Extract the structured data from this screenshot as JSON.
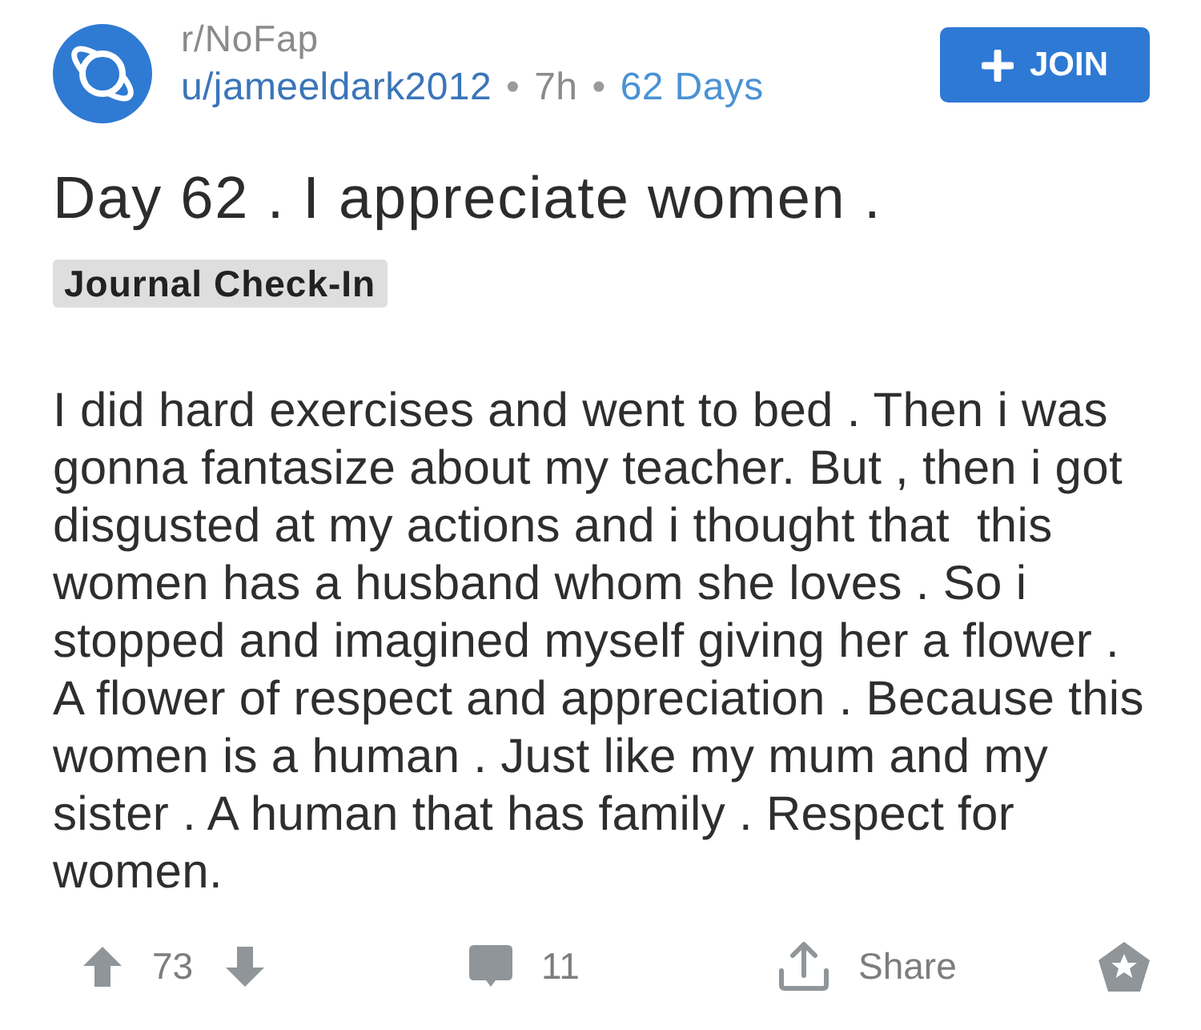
{
  "community": {
    "name": "r/NoFap"
  },
  "meta": [
    {
      "kind": "author",
      "text": "u/jameeldark2012"
    },
    {
      "kind": "separator",
      "text": "•"
    },
    {
      "kind": "age",
      "text": "7h"
    },
    {
      "kind": "separator",
      "text": "•"
    },
    {
      "kind": "user_flair",
      "text": "62 Days"
    }
  ],
  "join_button": {
    "label": "JOIN"
  },
  "post": {
    "title": "Day 62 . I appreciate women .",
    "flair": "Journal Check-In",
    "body": "I did hard exercises and went to bed . Then i was gonna fantasize about my teacher. But , then i got disgusted at my actions and i thought that  this women has a husband whom she loves . So i stopped and imagined myself giving her a flower . A flower of respect and appreciation . Because this women is a human . Just like my mum and my sister . A human that has family . Respect for women."
  },
  "actions": {
    "score": "73",
    "comments": "11",
    "share": "Share"
  }
}
